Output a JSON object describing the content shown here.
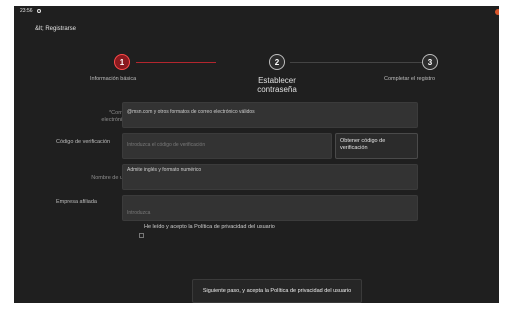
{
  "status": {
    "time": "23:56"
  },
  "header": {
    "title": "&lt; Registrarse"
  },
  "steps": [
    {
      "number": "1",
      "label": "Información básica"
    },
    {
      "number": "2",
      "label": "Establecer contraseña"
    },
    {
      "number": "3",
      "label": "Completar el registro"
    }
  ],
  "form": {
    "email": {
      "label": "*Correo electrónico",
      "value": "@msn.com y otros formatos de correo electrónico válidos"
    },
    "code": {
      "label": "Código de verificación",
      "placeholder": "Introduzca el código de verificación",
      "button": "Obtener código de verificación"
    },
    "username": {
      "label": "Nombre de usuario",
      "hint": "Admite inglés y formato numérico"
    },
    "company": {
      "label": "Empresa afiliada",
      "placeholder": "Introduzca"
    },
    "agreement": {
      "text": "He leído y acepto la Política de privacidad del usuario"
    }
  },
  "submit": {
    "label": "Siguiente paso, y acepta la Política de privacidad del usuario"
  }
}
